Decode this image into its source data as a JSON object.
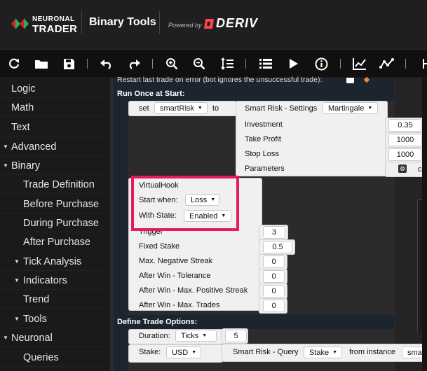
{
  "header": {
    "brand_line1": "NEURONAL",
    "brand_line2": "TRADER",
    "app_title": "Binary Tools",
    "powered_by": "Powered by",
    "deriv": "DERIV"
  },
  "colors": {
    "accent": "#e7195f",
    "deriv_red": "#ff444f",
    "brand_red": "#e31c2d",
    "brand_green": "#2bb24c"
  },
  "toolbar": {
    "items": [
      "refresh-icon",
      "folder-icon",
      "save-icon",
      "undo-icon",
      "redo-icon",
      "zoom-in-icon",
      "zoom-out-icon",
      "sort-icon",
      "list-icon",
      "play-icon",
      "info-icon",
      "chart-icon",
      "analysis-icon"
    ]
  },
  "sidebar": {
    "items": [
      {
        "label": "Logic",
        "level": 0,
        "arrow": ""
      },
      {
        "label": "Math",
        "level": 0,
        "arrow": ""
      },
      {
        "label": "Text",
        "level": 0,
        "arrow": ""
      },
      {
        "label": "Advanced",
        "level": 0,
        "arrow": "▼"
      },
      {
        "label": "Binary",
        "level": 0,
        "arrow": "▼"
      },
      {
        "label": "Trade Definition",
        "level": 1,
        "arrow": ""
      },
      {
        "label": "Before Purchase",
        "level": 1,
        "arrow": ""
      },
      {
        "label": "During Purchase",
        "level": 1,
        "arrow": ""
      },
      {
        "label": "After Purchase",
        "level": 1,
        "arrow": ""
      },
      {
        "label": "Tick Analysis",
        "level": 1,
        "arrow": "▼"
      },
      {
        "label": "Indicators",
        "level": 1,
        "arrow": "▼"
      },
      {
        "label": "Trend",
        "level": 1,
        "arrow": ""
      },
      {
        "label": "Tools",
        "level": 1,
        "arrow": "▼"
      },
      {
        "label": "Neuronal",
        "level": 0,
        "arrow": "▼"
      },
      {
        "label": "Queries",
        "level": 1,
        "arrow": ""
      }
    ]
  },
  "workspace": {
    "restart_text": "Restart last trade on error     (bot ignores the unsuccessful trade):",
    "run_once_title": "Run Once at Start:",
    "set_label": "set",
    "variable": "smartRisk",
    "to_label": "to",
    "settings_block": {
      "title": "Smart Risk - Settings",
      "mode": "Martingale",
      "rows": [
        {
          "label": "Investment",
          "value": "0.35"
        },
        {
          "label": "Take Profit",
          "value": "1000"
        },
        {
          "label": "Stop Loss",
          "value": "1000"
        },
        {
          "label": "Parameters",
          "value": "cre"
        }
      ]
    },
    "virtual_hook": {
      "title": "VirtualHook",
      "start_when_label": "Start when:",
      "start_when_value": "Loss",
      "with_state_label": "With State:",
      "with_state_value": "Enabled",
      "rows": [
        {
          "label": "Trigger",
          "value": "3"
        },
        {
          "label": "Fixed Stake",
          "value": "0.5"
        },
        {
          "label": "Max. Negative Streak",
          "value": "0"
        },
        {
          "label": "After Win - Tolerance",
          "value": "0"
        },
        {
          "label": "After Win - Max. Positive Streak",
          "value": "0"
        },
        {
          "label": "After Win - Max. Trades",
          "value": "0"
        }
      ]
    },
    "define_title": "Define Trade Options:",
    "duration_label": "Duration:",
    "duration_unit": "Ticks",
    "duration_value": "5",
    "stake_label": "Stake:",
    "stake_currency": "USD",
    "query_block": {
      "title": "Smart Risk - Query",
      "field": "Stake",
      "from_label": "from instance",
      "instance": "smartR"
    }
  }
}
